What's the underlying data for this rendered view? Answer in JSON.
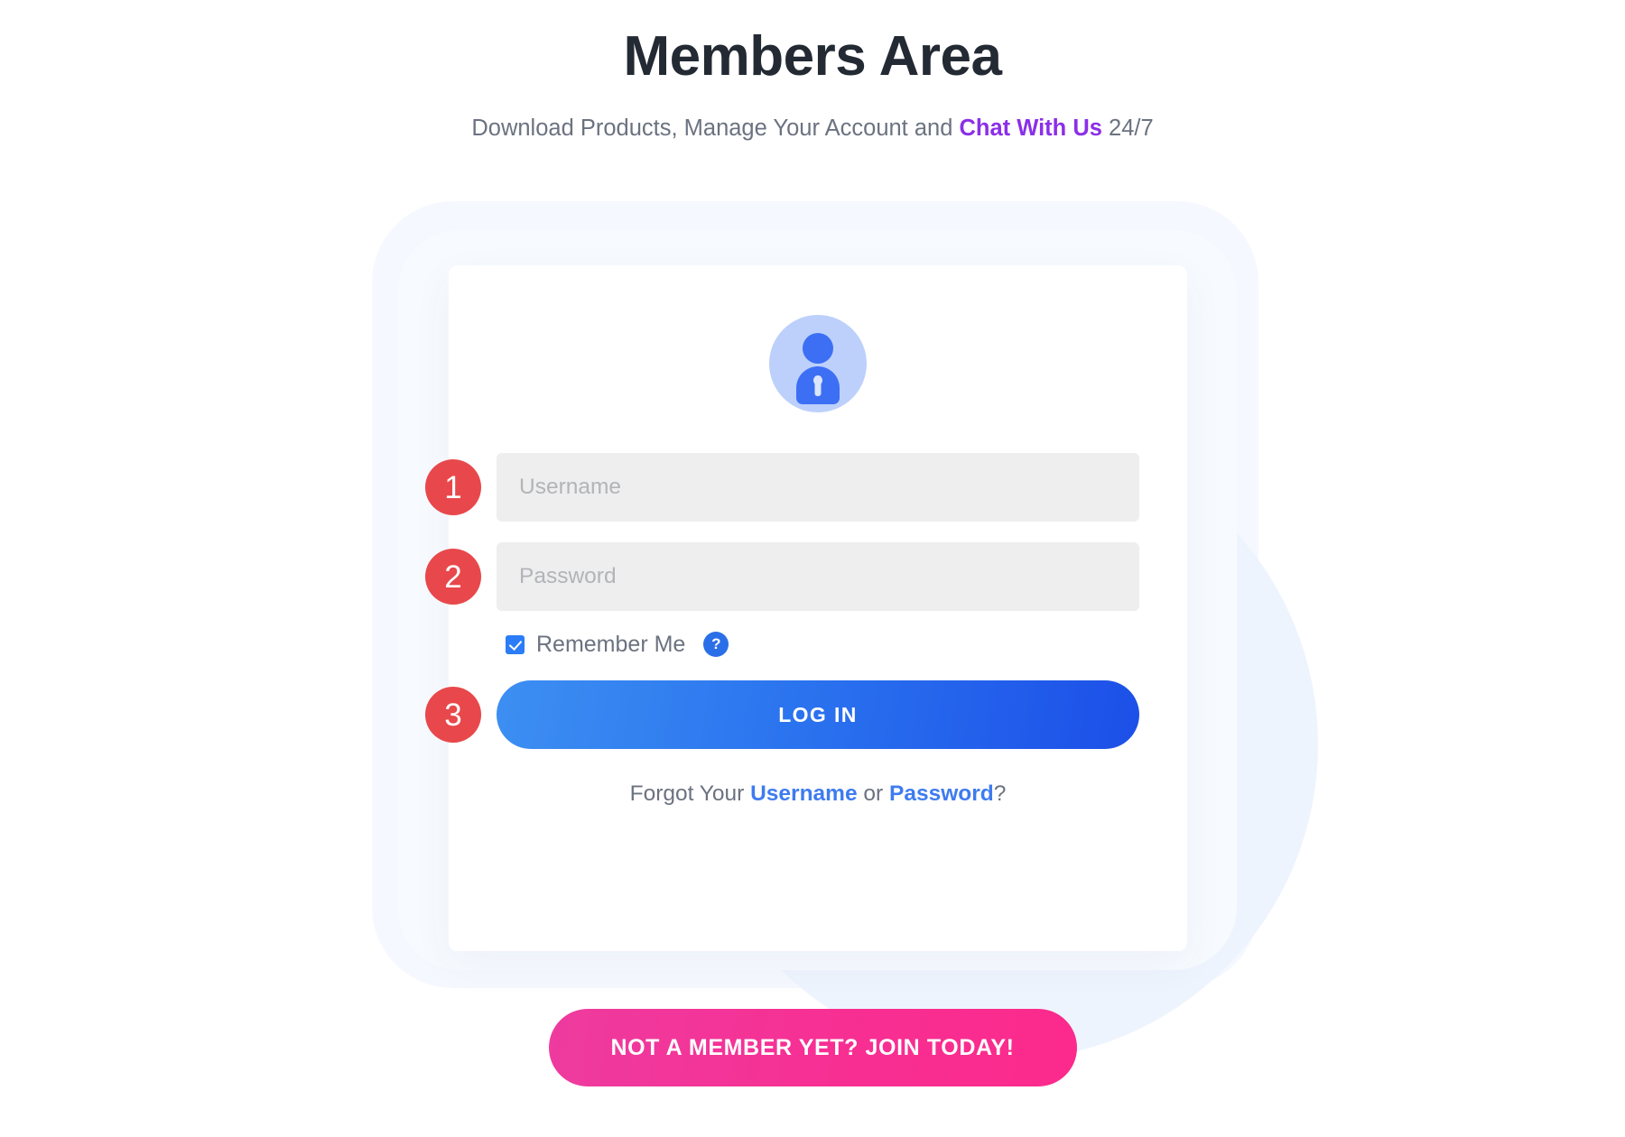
{
  "header": {
    "title": "Members Area",
    "subtitle_before": "Download Products, Manage Your Account and ",
    "subtitle_link": "Chat With Us",
    "subtitle_after": " 24/7"
  },
  "card": {
    "avatar_icon": "user-lock-avatar-icon",
    "fields": [
      {
        "step": "1",
        "name": "username",
        "placeholder": "Username",
        "value": ""
      },
      {
        "step": "2",
        "name": "password",
        "placeholder": "Password",
        "value": ""
      }
    ],
    "remember": {
      "label": "Remember Me",
      "checked": true,
      "help_icon": "?"
    },
    "login": {
      "step": "3",
      "label": "LOG IN"
    },
    "forgot": {
      "prefix": "Forgot Your ",
      "username_link": "Username",
      "separator": " or ",
      "password_link": "Password",
      "suffix": "?"
    }
  },
  "join": {
    "label": "NOT A MEMBER YET? JOIN TODAY!"
  },
  "colors": {
    "title": "#242a33",
    "subtitle": "#6b7280",
    "chat_link": "#8b2fe8",
    "step_badge": "#e8484b",
    "login_gradient_start": "#3d8ff2",
    "login_gradient_end": "#1c4fe8",
    "join_gradient_start": "#ee3b9f",
    "join_gradient_end": "#fc2a8c",
    "link_blue": "#3e7bf0",
    "avatar_bg": "#bcd0fb",
    "avatar_fg": "#3d6ff5",
    "field_bg": "#eeeeee",
    "checkbox": "#2b7cf6",
    "help_icon": "#2b6fe8",
    "blob": "#eef4fd"
  }
}
